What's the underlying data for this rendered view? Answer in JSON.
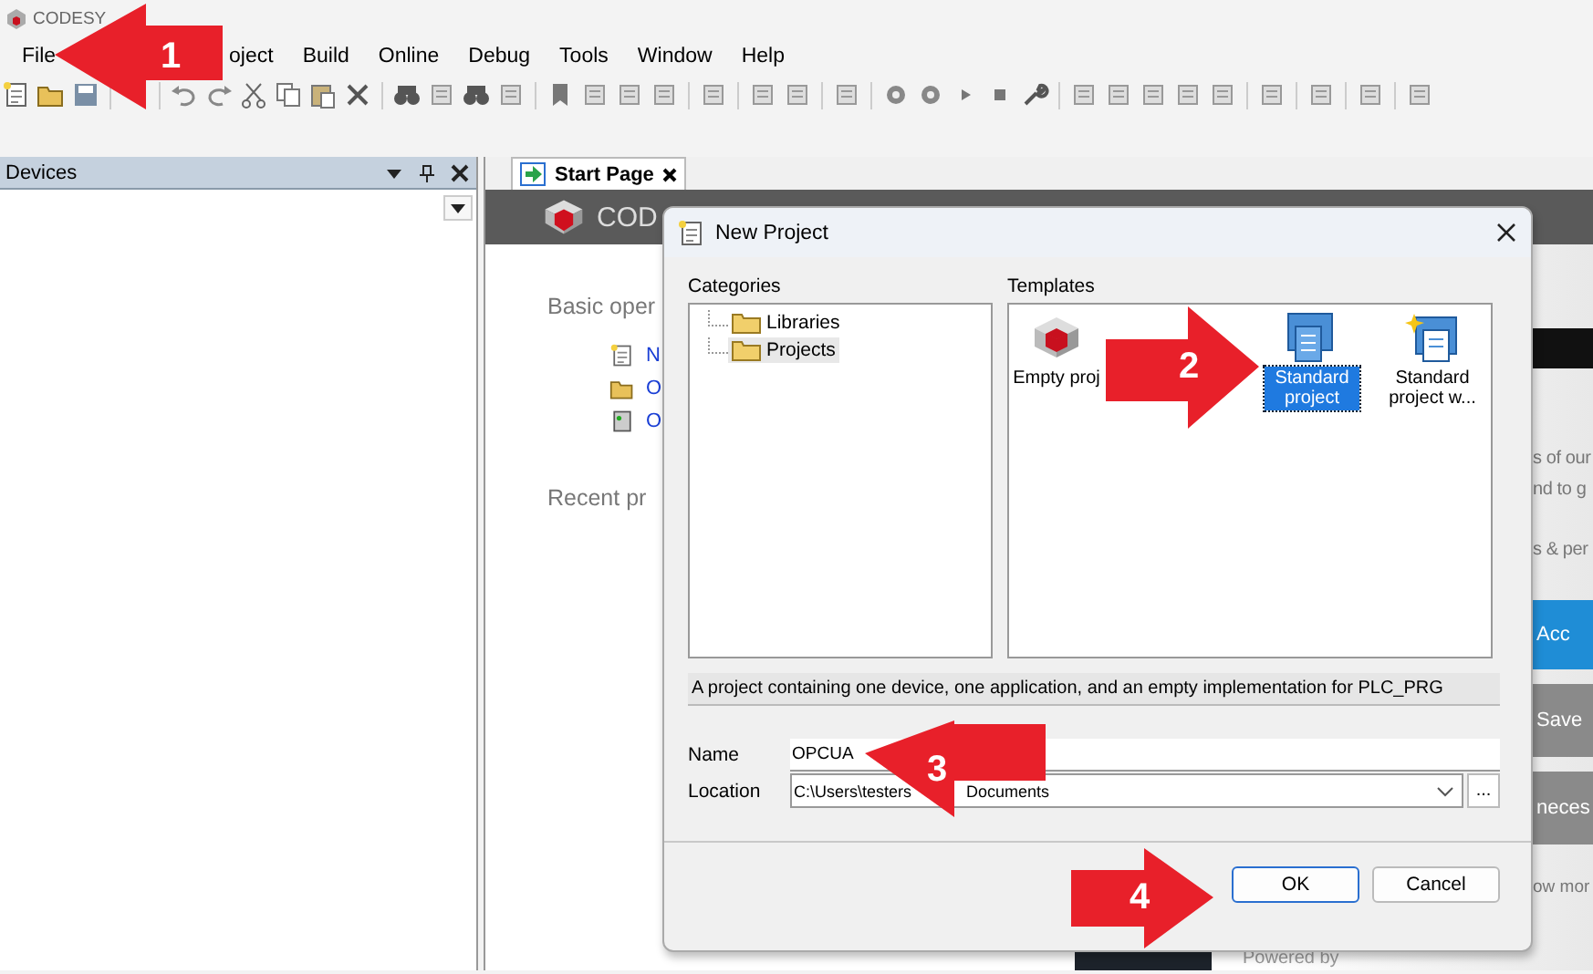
{
  "window": {
    "title": "CODESY"
  },
  "menu": [
    "File",
    "oject",
    "Build",
    "Online",
    "Debug",
    "Tools",
    "Window",
    "Help"
  ],
  "devices_pane": {
    "title": "Devices"
  },
  "editor_tabs": [
    {
      "label": "Start Page",
      "selected": true
    }
  ],
  "start_page": {
    "brand": "COD",
    "basic_heading": "Basic oper",
    "links": [
      "N",
      "O",
      "O"
    ],
    "recent_heading": "Recent pr",
    "right_texts": [
      "s of our",
      "nd to g",
      "s & per"
    ],
    "buttons": [
      {
        "label": "Acc",
        "kind": "primary"
      },
      {
        "label": "Save",
        "kind": "secondary"
      },
      {
        "label": "neces",
        "kind": "secondary"
      }
    ],
    "more": "ow mor",
    "footer": "Powered by"
  },
  "dialog": {
    "title": "New Project",
    "categories_label": "Categories",
    "categories": [
      {
        "label": "Libraries",
        "selected": false
      },
      {
        "label": "Projects",
        "selected": true
      }
    ],
    "templates_label": "Templates",
    "templates": [
      {
        "label": "Empty proj",
        "kind": "empty",
        "selected": false
      },
      {
        "label": "Standard project",
        "kind": "standard",
        "selected": true
      },
      {
        "label": "Standard project w...",
        "kind": "wizard",
        "selected": false
      }
    ],
    "description": "A project containing one device, one application, and an empty implementation for PLC_PRG",
    "name_label": "Name",
    "name_value": "OPCUA",
    "location_label": "Location",
    "location_value": [
      "C:\\Users\\testers",
      "Documents"
    ],
    "browse": "...",
    "buttons": [
      {
        "label": "OK",
        "kind": "default"
      },
      {
        "label": "Cancel",
        "kind": "normal"
      }
    ]
  },
  "annotations": [
    {
      "number": "1"
    },
    {
      "number": "2"
    },
    {
      "number": "3"
    },
    {
      "number": "4"
    }
  ]
}
